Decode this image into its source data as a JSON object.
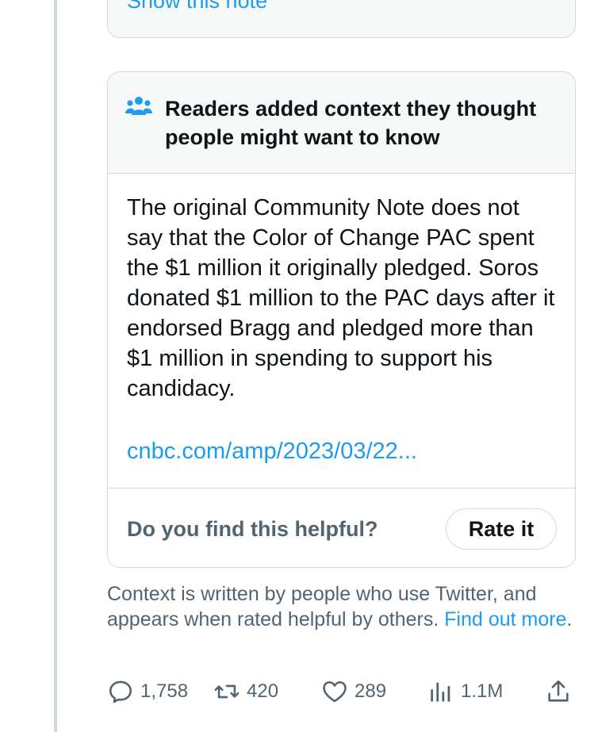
{
  "previous_note": {
    "show_label": "Show this note"
  },
  "note": {
    "header_title": "Readers added context they thought people might want to know",
    "header_icon": "people-icon",
    "body": "The original Community Note does not say that the Color of Change PAC spent the $1 million it originally pledged. Soros donated $1 million to the PAC days after it endorsed Bragg and pledged more than $1 million in spending to support his candidacy.",
    "link": "cnbc.com/amp/2023/03/22...",
    "helpful_question": "Do you find this helpful?",
    "rate_label": "Rate it"
  },
  "context": {
    "text": "Context is written by people who use Twitter, and appears when rated helpful by others.",
    "find_out_label": "Find out more",
    "period": "."
  },
  "actions": {
    "replies": "1,758",
    "retweets": "420",
    "likes": "289",
    "views": "1.1M"
  },
  "colors": {
    "accent": "#1d9bf0",
    "text": "#0f1419",
    "secondary_text": "#536471",
    "border": "#cfd9de",
    "header_bg": "#f7f9f9"
  }
}
